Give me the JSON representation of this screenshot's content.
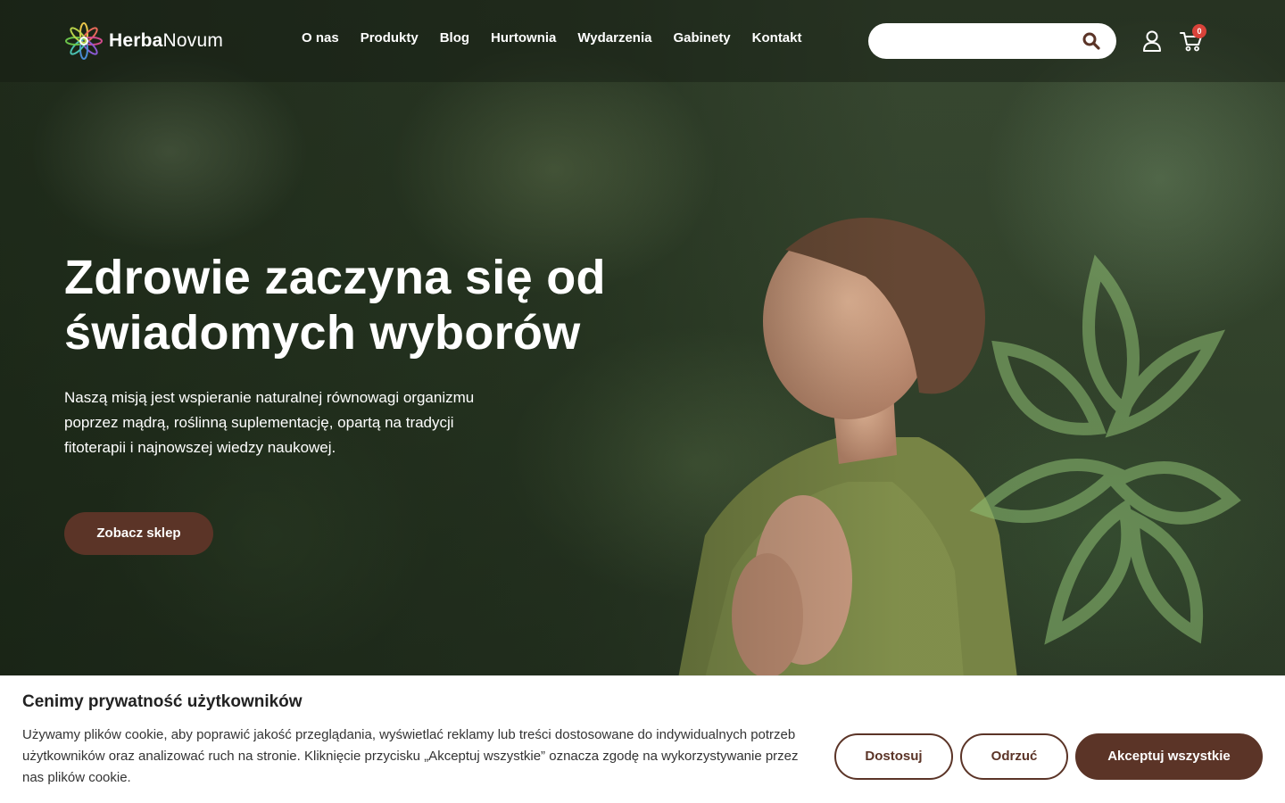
{
  "brand": {
    "name_bold": "Herba",
    "name_light": "Novum"
  },
  "nav": {
    "items": [
      {
        "label": "O nas"
      },
      {
        "label": "Produkty"
      },
      {
        "label": "Blog"
      },
      {
        "label": "Hurtownia"
      },
      {
        "label": "Wydarzenia"
      },
      {
        "label": "Gabinety"
      },
      {
        "label": "Kontakt"
      }
    ]
  },
  "search": {
    "placeholder": "",
    "icon": "search-icon"
  },
  "account": {
    "icon": "user-icon"
  },
  "cart": {
    "icon": "cart-icon",
    "count": "0"
  },
  "hero": {
    "title_line1": "Zdrowie zaczyna się od",
    "title_line2": "świadomych wyborów",
    "description": "Naszą misją jest wspieranie naturalnej równowagi organizmu poprzez mądrą, roślinną suplementację, opartą na tradycji fitoterapii i najnowszej wiedzy naukowej.",
    "cta_label": "Zobacz sklep"
  },
  "cookie": {
    "title": "Cenimy prywatność użytkowników",
    "text": "Używamy plików cookie, aby poprawić jakość przeglądania, wyświetlać reklamy lub treści dostosowane do indywidualnych potrzeb użytkowników oraz analizować ruch na stronie. Kliknięcie przycisku „Akceptuj wszystkie” oznacza zgodę na wykorzystywanie przez nas plików cookie.",
    "customize_label": "Dostosuj",
    "reject_label": "Odrzuć",
    "accept_label": "Akceptuj wszystkie"
  },
  "colors": {
    "accent_brown": "#5b3427",
    "badge_red": "#d9433a",
    "text_white": "#ffffff"
  }
}
